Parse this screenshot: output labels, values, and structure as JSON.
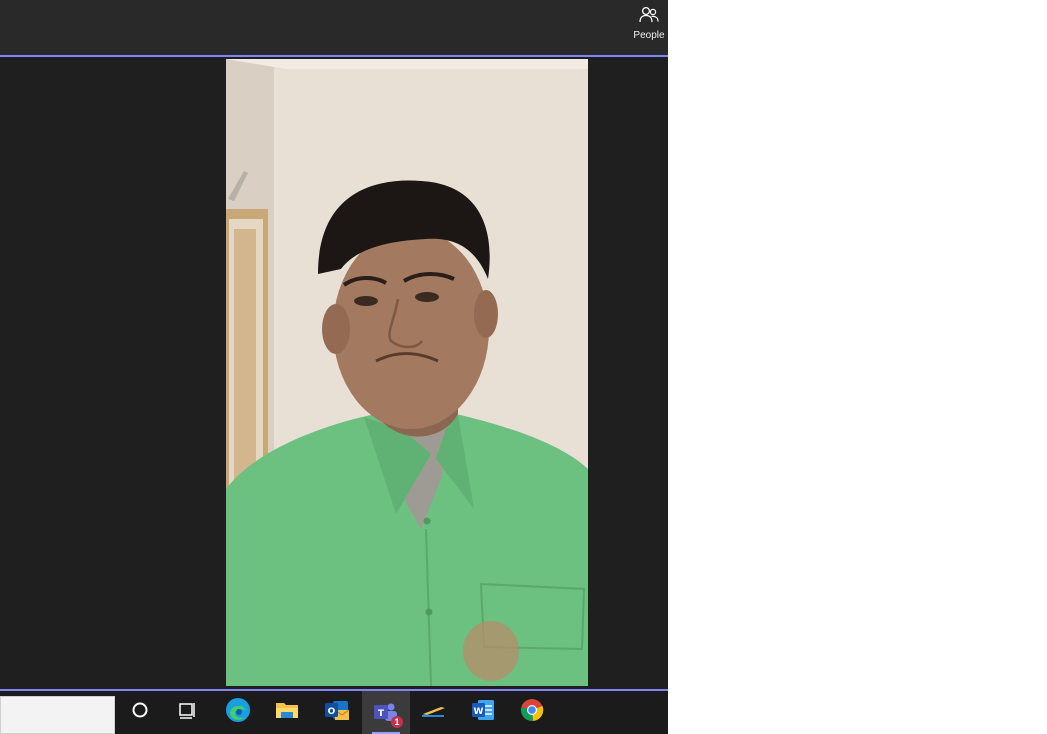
{
  "header": {
    "people_label": "People"
  },
  "taskbar": {
    "apps": [
      "cortana",
      "task-view",
      "edge",
      "file-explorer",
      "outlook",
      "teams",
      "sticky-notes",
      "word",
      "chrome"
    ],
    "teams_badge": "1"
  },
  "colors": {
    "accent": "#7f85f5",
    "background": "#1f1f1f",
    "topbar": "#292929",
    "shirt": "#6cc080"
  }
}
